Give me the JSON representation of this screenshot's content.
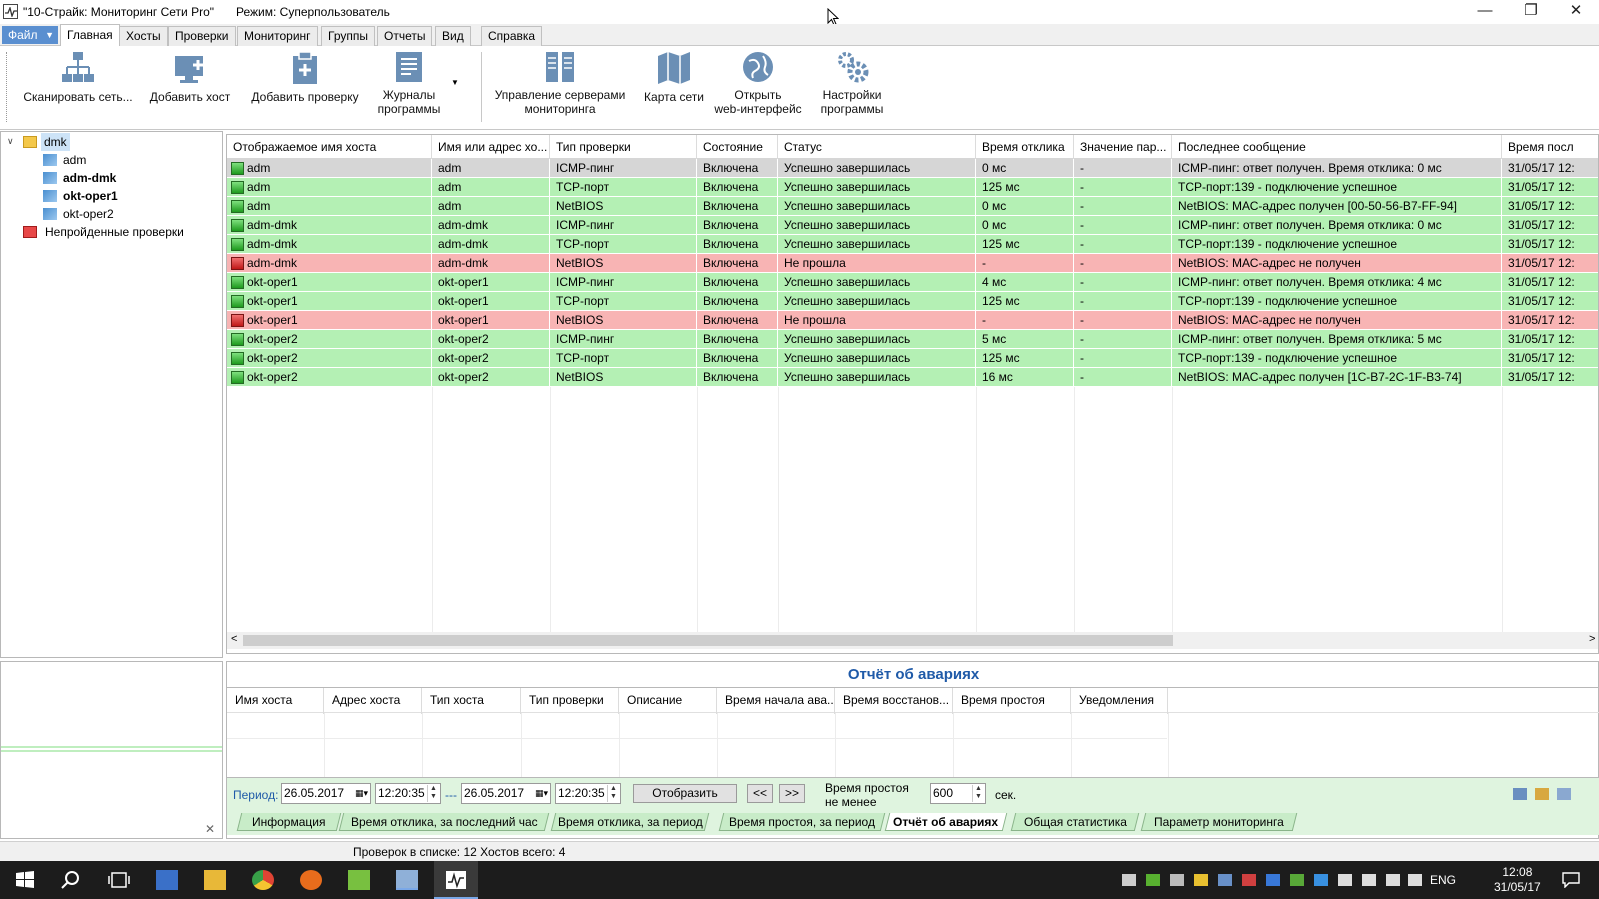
{
  "window": {
    "title": "\"10-Страйк: Мониторинг Сети Pro\"",
    "mode": "Режим: Суперпользователь",
    "minimize": "—",
    "restore": "❐",
    "close": "✕"
  },
  "menu": {
    "file": "Файл",
    "tabs": [
      "Главная",
      "Хосты",
      "Проверки",
      "Мониторинг",
      "Группы",
      "Отчеты",
      "Вид",
      "Справка"
    ]
  },
  "ribbon": {
    "scan": "Сканировать сеть...",
    "add_host": "Добавить хост",
    "add_check": "Добавить проверку",
    "logs": [
      "Журналы",
      "программы"
    ],
    "servers": [
      "Управление серверами",
      "мониторинга"
    ],
    "map": "Карта сети",
    "web": [
      "Открыть",
      "web-интерфейс"
    ],
    "settings": [
      "Настройки",
      "программы"
    ]
  },
  "tree": {
    "root": "dmk",
    "children": [
      "adm",
      "adm-dmk",
      "okt-oper1",
      "okt-oper2"
    ],
    "failed": "Непройденные проверки"
  },
  "grid": {
    "columns": [
      "Отображаемое имя хоста",
      "Имя или адрес хо...",
      "Тип проверки",
      "Состояние",
      "Статус",
      "Время отклика",
      "Значение пар...",
      "Последнее сообщение",
      "Время посл"
    ],
    "rows": [
      {
        "name": "adm",
        "addr": "adm",
        "type": "ICMP-пинг",
        "state": "Включена",
        "status": "Успешно завершилась",
        "resp": "0 мс",
        "val": "-",
        "msg": "ICMP-пинг: ответ получен. Время отклика: 0 мс",
        "time": "31/05/17 12:",
        "kind": "sel"
      },
      {
        "name": "adm",
        "addr": "adm",
        "type": "TCP-порт",
        "state": "Включена",
        "status": "Успешно завершилась",
        "resp": "125 мс",
        "val": "-",
        "msg": "TCP-порт:139 - подключение успешное",
        "time": "31/05/17 12:",
        "kind": "ok"
      },
      {
        "name": "adm",
        "addr": "adm",
        "type": "NetBIOS",
        "state": "Включена",
        "status": "Успешно завершилась",
        "resp": "0 мс",
        "val": "-",
        "msg": "NetBIOS: МАС-адрес получен [00-50-56-B7-FF-94]",
        "time": "31/05/17 12:",
        "kind": "ok"
      },
      {
        "name": "adm-dmk",
        "addr": "adm-dmk",
        "type": "ICMP-пинг",
        "state": "Включена",
        "status": "Успешно завершилась",
        "resp": "0 мс",
        "val": "-",
        "msg": "ICMP-пинг: ответ получен. Время отклика: 0 мс",
        "time": "31/05/17 12:",
        "kind": "ok"
      },
      {
        "name": "adm-dmk",
        "addr": "adm-dmk",
        "type": "TCP-порт",
        "state": "Включена",
        "status": "Успешно завершилась",
        "resp": "125 мс",
        "val": "-",
        "msg": "TCP-порт:139 - подключение успешное",
        "time": "31/05/17 12:",
        "kind": "ok"
      },
      {
        "name": "adm-dmk",
        "addr": "adm-dmk",
        "type": "NetBIOS",
        "state": "Включена",
        "status": "Не прошла",
        "resp": "-",
        "val": "-",
        "msg": "NetBIOS: МАС-адрес не получен",
        "time": "31/05/17 12:",
        "kind": "bad"
      },
      {
        "name": "okt-oper1",
        "addr": "okt-oper1",
        "type": "ICMP-пинг",
        "state": "Включена",
        "status": "Успешно завершилась",
        "resp": "4 мс",
        "val": "-",
        "msg": "ICMP-пинг: ответ получен. Время отклика: 4 мс",
        "time": "31/05/17 12:",
        "kind": "ok"
      },
      {
        "name": "okt-oper1",
        "addr": "okt-oper1",
        "type": "TCP-порт",
        "state": "Включена",
        "status": "Успешно завершилась",
        "resp": "125 мс",
        "val": "-",
        "msg": "TCP-порт:139 - подключение успешное",
        "time": "31/05/17 12:",
        "kind": "ok"
      },
      {
        "name": "okt-oper1",
        "addr": "okt-oper1",
        "type": "NetBIOS",
        "state": "Включена",
        "status": "Не прошла",
        "resp": "-",
        "val": "-",
        "msg": "NetBIOS: МАС-адрес не получен",
        "time": "31/05/17 12:",
        "kind": "bad"
      },
      {
        "name": "okt-oper2",
        "addr": "okt-oper2",
        "type": "ICMP-пинг",
        "state": "Включена",
        "status": "Успешно завершилась",
        "resp": "5 мс",
        "val": "-",
        "msg": "ICMP-пинг: ответ получен. Время отклика: 5 мс",
        "time": "31/05/17 12:",
        "kind": "ok"
      },
      {
        "name": "okt-oper2",
        "addr": "okt-oper2",
        "type": "TCP-порт",
        "state": "Включена",
        "status": "Успешно завершилась",
        "resp": "125 мс",
        "val": "-",
        "msg": "TCP-порт:139 - подключение успешное",
        "time": "31/05/17 12:",
        "kind": "ok"
      },
      {
        "name": "okt-oper2",
        "addr": "okt-oper2",
        "type": "NetBIOS",
        "state": "Включена",
        "status": "Успешно завершилась",
        "resp": "16 мс",
        "val": "-",
        "msg": "NetBIOS: МАС-адрес получен [1C-B7-2C-1F-B3-74]",
        "time": "31/05/17 12:",
        "kind": "ok"
      }
    ]
  },
  "report": {
    "title": "Отчёт об авариях",
    "columns": [
      "Имя хоста",
      "Адрес хоста",
      "Тип хоста",
      "Тип проверки",
      "Описание",
      "Время начала ава...",
      "Время восстанов...",
      "Время простоя",
      "Уведомления"
    ],
    "period_label": "Период:",
    "date_from": "26.05.2017",
    "time_from": "12:20:35",
    "dash": "---",
    "date_to": "26.05.2017",
    "time_to": "12:20:35",
    "show_button": "Отобразить",
    "prev": "<<",
    "next": ">>",
    "downtime_label": [
      "Время простоя",
      "не менее"
    ],
    "downtime_value": "600",
    "downtime_unit": "сек.",
    "tabs": [
      "Информация",
      "Время отклика, за последний час",
      "Время отклика, за период",
      "Время простоя, за период",
      "Отчёт об авариях",
      "Общая статистика",
      "Параметр мониторинга"
    ],
    "active_tab": "Отчёт об авариях"
  },
  "statusbar": {
    "text": "Проверок в списке: 12  Хостов всего: 4"
  },
  "taskbar": {
    "lang": "ENG",
    "time": "12:08",
    "date": "31/05/17"
  },
  "colors": {
    "ok_row": "#b4f0b4",
    "bad_row": "#f8b4b4",
    "accent": "#1f5aa8"
  }
}
